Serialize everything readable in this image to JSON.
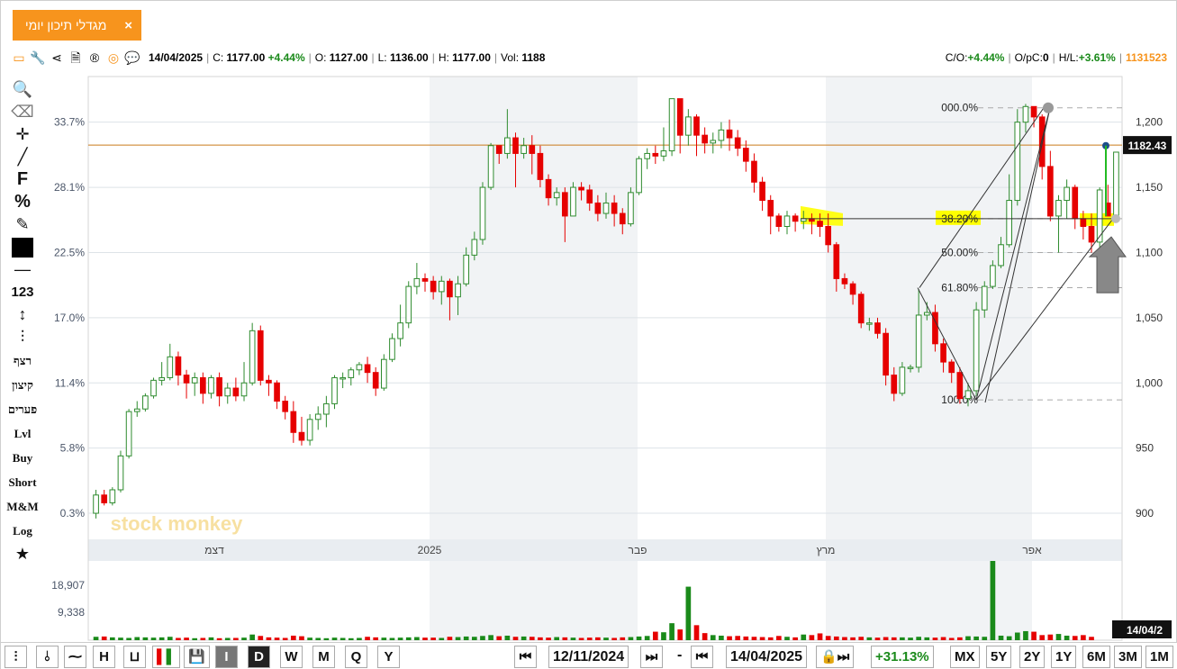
{
  "tab": {
    "title": "מגדלי תיכון יומי",
    "close": "×"
  },
  "info": {
    "date": "14/04/2025",
    "close_label": "C:",
    "close": "1177.00",
    "change": "+4.44%",
    "open_label": "O:",
    "open": "1127.00",
    "low_label": "L:",
    "low": "1136.00",
    "high_label": "H:",
    "high": "1177.00",
    "vol_label": "Vol:",
    "vol": "1188",
    "co_label": "C/O:",
    "co": "+4.44%",
    "opc_label": "O/pC:",
    "opc": "0",
    "hl_label": "H/L:",
    "hl": "+3.61%",
    "code": "1131523"
  },
  "left_tools": {
    "f": "F",
    "pct": "%",
    "num": "123",
    "t1": "רצף",
    "t2": "קיצון",
    "t3": "פערים",
    "lvl": "Lvl",
    "buy": "Buy",
    "short": "Short",
    "mm": "M&M",
    "log": "Log"
  },
  "colors": {
    "up": "#2e8b2e",
    "down": "#e60000",
    "accent": "#f7941d",
    "fib_highlight": "#ffff00"
  },
  "bottom": {
    "intervals": [
      "I",
      "D",
      "W",
      "M",
      "Q",
      "Y"
    ],
    "from_date": "12/11/2024",
    "dash": "-",
    "to_date": "14/04/2025",
    "period_change": "+31.13%",
    "ranges": [
      "MX",
      "5Y",
      "2Y",
      "1Y",
      "6M",
      "3M",
      "1M"
    ]
  },
  "chart_data": {
    "type": "candlestick",
    "title": "",
    "watermark": "stock monkey",
    "x_month_labels": [
      "דצמ",
      "2025",
      "פבר",
      "מרץ",
      "אפר"
    ],
    "y_right_ticks": [
      "1,200",
      "1,150",
      "1,100",
      "1,050",
      "1,000",
      "950",
      "900"
    ],
    "y_left_ticks": [
      "33.7%",
      "28.1%",
      "22.5%",
      "17.0%",
      "11.4%",
      "5.8%",
      "0.3%"
    ],
    "ylim": [
      880,
      1235
    ],
    "last_price_label": "1182.43",
    "horizontal_line": 1182.43,
    "fib_levels": [
      {
        "label": "000.0%",
        "value": 1211
      },
      {
        "label": "38.20%",
        "value": 1126
      },
      {
        "label": "50.00%",
        "value": 1100
      },
      {
        "label": "61.80%",
        "value": 1073
      },
      {
        "label": "100.0%",
        "value": 987
      }
    ],
    "volume_ticks": [
      "18,907",
      "9,338"
    ],
    "volume_last_date": "14/04/2",
    "candles": [
      [
        900,
        914,
        896,
        918
      ],
      [
        914,
        908,
        906,
        918
      ],
      [
        908,
        918,
        906,
        920
      ],
      [
        918,
        944,
        916,
        948
      ],
      [
        944,
        978,
        942,
        980
      ],
      [
        978,
        980,
        974,
        986
      ],
      [
        980,
        990,
        978,
        992
      ],
      [
        990,
        1002,
        988,
        1004
      ],
      [
        1002,
        1004,
        998,
        1016
      ],
      [
        1004,
        1020,
        1002,
        1030
      ],
      [
        1020,
        1006,
        998,
        1024
      ],
      [
        1006,
        1000,
        988,
        1010
      ],
      [
        1000,
        1004,
        990,
        1008
      ],
      [
        1004,
        992,
        984,
        1008
      ],
      [
        992,
        1004,
        988,
        1006
      ],
      [
        1004,
        990,
        982,
        1008
      ],
      [
        990,
        996,
        984,
        1000
      ],
      [
        996,
        990,
        986,
        1004
      ],
      [
        990,
        1000,
        986,
        1016
      ],
      [
        1000,
        1040,
        998,
        1046
      ],
      [
        1040,
        1002,
        998,
        1044
      ],
      [
        1002,
        1000,
        990,
        1006
      ],
      [
        1000,
        986,
        980,
        1002
      ],
      [
        986,
        978,
        972,
        990
      ],
      [
        978,
        962,
        954,
        986
      ],
      [
        962,
        956,
        952,
        974
      ],
      [
        956,
        972,
        952,
        976
      ],
      [
        972,
        976,
        964,
        982
      ],
      [
        976,
        984,
        966,
        990
      ],
      [
        984,
        1004,
        980,
        1006
      ],
      [
        1004,
        1004,
        996,
        1008
      ],
      [
        1004,
        1010,
        998,
        1012
      ],
      [
        1010,
        1014,
        1006,
        1016
      ],
      [
        1014,
        1008,
        1000,
        1020
      ],
      [
        1008,
        996,
        990,
        1012
      ],
      [
        996,
        1018,
        994,
        1022
      ],
      [
        1018,
        1034,
        1016,
        1038
      ],
      [
        1034,
        1046,
        1028,
        1060
      ],
      [
        1046,
        1074,
        1042,
        1078
      ],
      [
        1074,
        1080,
        1068,
        1092
      ],
      [
        1080,
        1078,
        1070,
        1084
      ],
      [
        1078,
        1070,
        1064,
        1082
      ],
      [
        1070,
        1078,
        1060,
        1082
      ],
      [
        1078,
        1066,
        1048,
        1080
      ],
      [
        1066,
        1076,
        1052,
        1082
      ],
      [
        1076,
        1098,
        1074,
        1104
      ],
      [
        1098,
        1110,
        1094,
        1116
      ],
      [
        1110,
        1150,
        1106,
        1154
      ],
      [
        1150,
        1182,
        1148,
        1184
      ],
      [
        1182,
        1176,
        1168,
        1182
      ],
      [
        1176,
        1188,
        1172,
        1210
      ],
      [
        1188,
        1176,
        1150,
        1192
      ],
      [
        1176,
        1182,
        1172,
        1188
      ],
      [
        1182,
        1176,
        1160,
        1190
      ],
      [
        1176,
        1156,
        1150,
        1182
      ],
      [
        1156,
        1142,
        1136,
        1160
      ],
      [
        1142,
        1146,
        1136,
        1150
      ],
      [
        1146,
        1128,
        1108,
        1150
      ],
      [
        1128,
        1150,
        1142,
        1154
      ],
      [
        1150,
        1148,
        1140,
        1154
      ],
      [
        1148,
        1138,
        1132,
        1152
      ],
      [
        1138,
        1130,
        1124,
        1144
      ],
      [
        1130,
        1138,
        1126,
        1146
      ],
      [
        1138,
        1130,
        1120,
        1144
      ],
      [
        1130,
        1122,
        1114,
        1134
      ],
      [
        1122,
        1146,
        1120,
        1150
      ],
      [
        1146,
        1172,
        1144,
        1174
      ],
      [
        1172,
        1176,
        1164,
        1180
      ],
      [
        1176,
        1174,
        1168,
        1182
      ],
      [
        1174,
        1178,
        1170,
        1196
      ],
      [
        1178,
        1218,
        1174,
        1218
      ],
      [
        1218,
        1190,
        1176,
        1218
      ],
      [
        1190,
        1204,
        1182,
        1210
      ],
      [
        1204,
        1190,
        1174,
        1206
      ],
      [
        1190,
        1184,
        1176,
        1196
      ],
      [
        1184,
        1186,
        1176,
        1192
      ],
      [
        1186,
        1194,
        1180,
        1200
      ],
      [
        1194,
        1188,
        1178,
        1202
      ],
      [
        1188,
        1180,
        1174,
        1194
      ],
      [
        1180,
        1170,
        1162,
        1186
      ],
      [
        1170,
        1154,
        1146,
        1176
      ],
      [
        1154,
        1140,
        1132,
        1158
      ],
      [
        1140,
        1128,
        1114,
        1144
      ],
      [
        1128,
        1120,
        1116,
        1130
      ],
      [
        1120,
        1128,
        1114,
        1132
      ],
      [
        1128,
        1124,
        1116,
        1130
      ],
      [
        1124,
        1126,
        1118,
        1132
      ],
      [
        1126,
        1124,
        1114,
        1130
      ],
      [
        1124,
        1120,
        1112,
        1130
      ],
      [
        1120,
        1106,
        1100,
        1130
      ],
      [
        1106,
        1080,
        1070,
        1108
      ],
      [
        1080,
        1076,
        1072,
        1084
      ],
      [
        1076,
        1068,
        1060,
        1078
      ],
      [
        1068,
        1046,
        1042,
        1070
      ],
      [
        1046,
        1046,
        1040,
        1050
      ],
      [
        1046,
        1038,
        1034,
        1050
      ],
      [
        1038,
        1006,
        998,
        1042
      ],
      [
        1006,
        992,
        986,
        1012
      ],
      [
        992,
        1012,
        990,
        1016
      ],
      [
        1012,
        1012,
        1008,
        1014
      ],
      [
        1012,
        1052,
        1008,
        1072
      ],
      [
        1052,
        1054,
        1048,
        1062
      ],
      [
        1054,
        1030,
        1024,
        1060
      ],
      [
        1030,
        1016,
        1008,
        1034
      ],
      [
        1016,
        1008,
        1000,
        1018
      ],
      [
        1008,
        988,
        984,
        1012
      ],
      [
        988,
        994,
        982,
        1000
      ],
      [
        994,
        1056,
        990,
        1062
      ],
      [
        1056,
        1074,
        1050,
        1078
      ],
      [
        1074,
        1090,
        1072,
        1094
      ],
      [
        1090,
        1106,
        1088,
        1112
      ],
      [
        1106,
        1140,
        1104,
        1160
      ],
      [
        1140,
        1200,
        1136,
        1210
      ],
      [
        1200,
        1212,
        1192,
        1214
      ],
      [
        1212,
        1204,
        1196,
        1212
      ],
      [
        1204,
        1166,
        1156,
        1206
      ],
      [
        1166,
        1128,
        1124,
        1178
      ],
      [
        1128,
        1140,
        1100,
        1144
      ],
      [
        1140,
        1150,
        1126,
        1156
      ],
      [
        1150,
        1126,
        1118,
        1152
      ],
      [
        1126,
        1120,
        1110,
        1132
      ],
      [
        1120,
        1108,
        1100,
        1130
      ],
      [
        1108,
        1148,
        1100,
        1150
      ],
      [
        1138,
        1128,
        1128,
        1152
      ],
      [
        1127,
        1177,
        1136,
        1177
      ]
    ],
    "volumes": [
      1200,
      1300,
      1000,
      900,
      800,
      1100,
      1000,
      900,
      1000,
      1200,
      800,
      900,
      700,
      800,
      1000,
      700,
      800,
      800,
      900,
      2000,
      1500,
      1000,
      900,
      800,
      1600,
      1400,
      900,
      800,
      700,
      900,
      800,
      700,
      800,
      1200,
      1000,
      900,
      800,
      900,
      1000,
      1100,
      900,
      900,
      800,
      1200,
      1100,
      1300,
      1200,
      1500,
      1800,
      1400,
      1600,
      1200,
      1300,
      1200,
      1000,
      900,
      1100,
      1000,
      900,
      800,
      900,
      1000,
      900,
      800,
      1000,
      1100,
      1300,
      1500,
      3000,
      2800,
      6000,
      3800,
      18907,
      5300,
      2500,
      1800,
      1600,
      1400,
      1500,
      1300,
      1200,
      1100,
      1000,
      1500,
      1200,
      1000,
      2000,
      1800,
      2400,
      1500,
      1300,
      1100,
      1000,
      1200,
      1000,
      900,
      1100,
      1000,
      1000,
      900,
      1200,
      1000,
      900,
      1100,
      800,
      1000,
      1400,
      1300,
      1200,
      28000,
      1600,
      1400,
      2700,
      3200,
      3000,
      1800,
      2000,
      2200,
      1600,
      1500,
      1800,
      1188
    ]
  }
}
